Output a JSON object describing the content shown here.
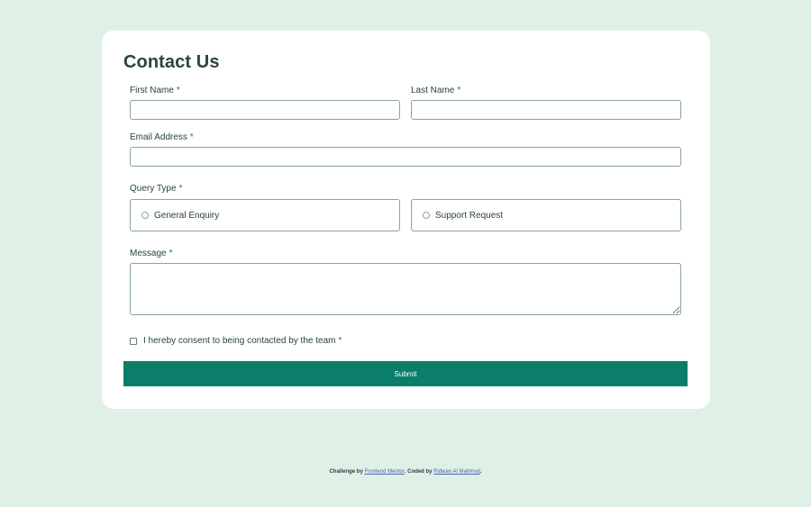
{
  "form": {
    "title": "Contact Us",
    "required_marker": "*",
    "first_name": {
      "label": "First Name",
      "value": ""
    },
    "last_name": {
      "label": "Last Name",
      "value": ""
    },
    "email": {
      "label": "Email Address",
      "value": ""
    },
    "query_type": {
      "label": "Query Type",
      "options": [
        "General Enquiry",
        "Support Request"
      ],
      "selected": null
    },
    "message": {
      "label": "Message",
      "value": ""
    },
    "consent": {
      "label": "I hereby consent to being contacted by the team",
      "checked": false
    },
    "submit_label": "Submit"
  },
  "footer": {
    "prefix": "Challenge by ",
    "link1": "Frontend Mentor",
    "middle": ". Coded by ",
    "link2": "Ridwan Al Mahmud",
    "suffix": "."
  },
  "colors": {
    "background": "#dff1e7",
    "card": "#ffffff",
    "accent": "#0c7d69",
    "text": "#2a4244",
    "border": "#87a3a6"
  }
}
